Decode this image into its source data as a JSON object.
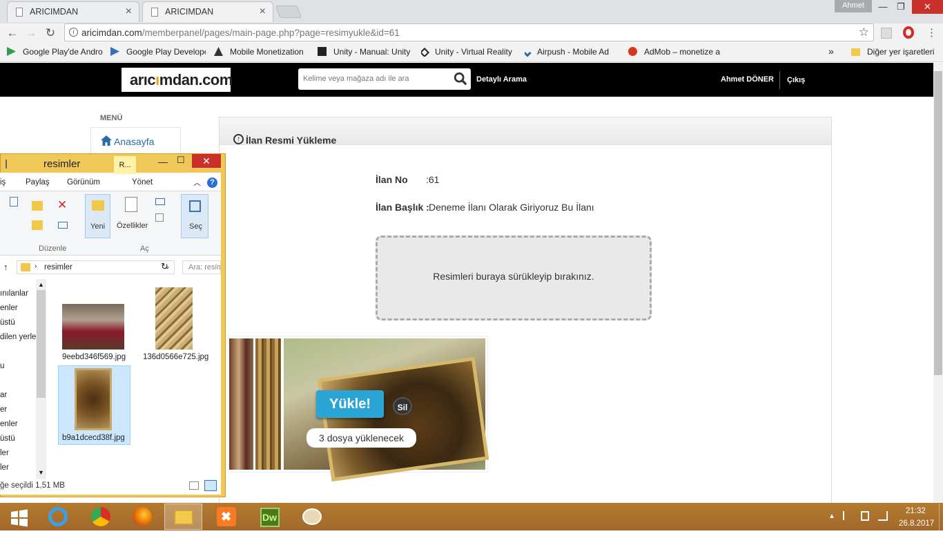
{
  "browser": {
    "tabs": [
      {
        "label": "ARICIMDAN"
      },
      {
        "label": "ARICIMDAN"
      }
    ],
    "user_badge": "Ahmet",
    "url_host": "aricimdan.com",
    "url_path": "/memberpanel/pages/main-page.php?page=resimyukle&id=61",
    "bookmarks": [
      {
        "label": "Google Play'de Andro",
        "icon": "play-icon",
        "color": "#2e9e4a"
      },
      {
        "label": "Google Play Develope",
        "icon": "play-console-icon",
        "color": "#3b6fb6"
      },
      {
        "label": "Mobile Monetization",
        "icon": "unity-ads-icon",
        "color": "#333333"
      },
      {
        "label": "Unity - Manual: Unity",
        "icon": "unity-icon",
        "color": "#222222"
      },
      {
        "label": "Unity - Virtual Reality",
        "icon": "unity-vr-icon",
        "color": "#222222"
      },
      {
        "label": "Airpush - Mobile Ad",
        "icon": "airpush-icon",
        "color": "#2a6aa8"
      },
      {
        "label": "AdMob – monetize a",
        "icon": "admob-icon",
        "color": "#d9361e"
      }
    ],
    "bookmarks_more": "»",
    "other_bookmarks": "Diğer yer işaretleri"
  },
  "site": {
    "logo_a": "arıc",
    "logo_o": "ı",
    "logo_b": "mdan.com",
    "search_placeholder": "Kelime veya mağaza adı ile ara",
    "advanced_search": "Detaylı Arama",
    "user_name": "Ahmet DÖNER",
    "logout": "Çıkış",
    "menu_title": "MENÜ",
    "menu_home": "Anasayfa"
  },
  "panel": {
    "title": "İlan Resmi Yükleme",
    "ilan_no_label": "İlan No",
    "ilan_no_value": ":61",
    "baslik_label": "İlan Başlık :",
    "baslik_value": "Deneme İlanı Olarak Giriyoruz Bu İlanı",
    "dropzone_text": "Resimleri buraya sürükleyip bırakınız.",
    "upload_button": "Yükle!",
    "delete_button": "Sil",
    "file_count": "3 dosya yüklenecek"
  },
  "explorer": {
    "title": "resimler",
    "tab_tag": "R...",
    "ribbon_tabs": [
      "iş",
      "Paylaş",
      "Görünüm",
      "Yönet"
    ],
    "groups": [
      "Düzenle",
      "Aç"
    ],
    "buttons": {
      "new": "Yeni",
      "properties": "Özellikler",
      "select": "Seç"
    },
    "address": "resimler",
    "search_placeholder": "Ara: resimler",
    "nav_items": [
      "ınılanlar",
      "enler",
      "üstü",
      "dilen yerle",
      "u",
      "ar",
      "er",
      "enler",
      "üstü",
      "ler",
      "ler"
    ],
    "files": [
      {
        "name": "9eebd346f569.jpg",
        "selected": false
      },
      {
        "name": "136d0566e725.jpg",
        "selected": false
      },
      {
        "name": "b9a1dcecd38f.jpg",
        "selected": true
      }
    ],
    "status": "ğe seçildi   1,51 MB"
  },
  "taskbar": {
    "time": "21:32",
    "date": "26.8.2017"
  }
}
